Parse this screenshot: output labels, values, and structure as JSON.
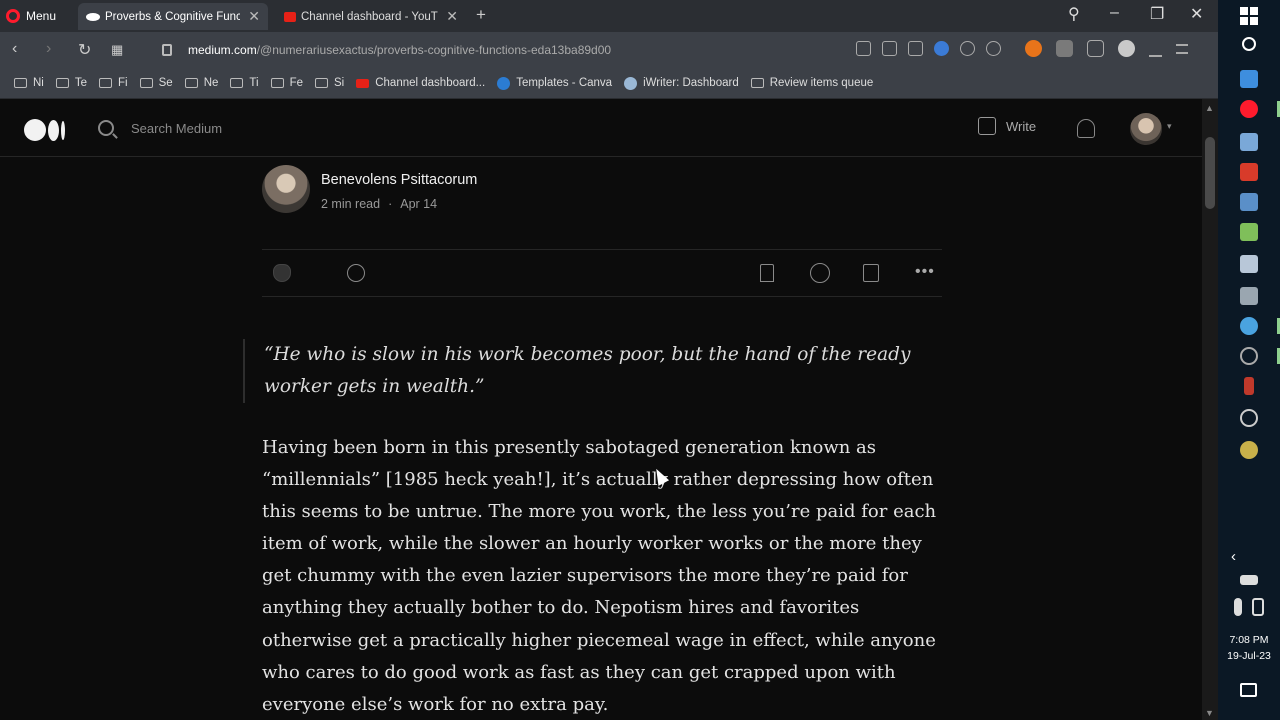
{
  "browser": {
    "menu_label": "Menu",
    "tabs": [
      {
        "title": "Proverbs & Cognitive Func",
        "favicon_color": "#ffffff"
      },
      {
        "title": "Channel dashboard - YouT",
        "favicon_color": "#e62117"
      }
    ],
    "url_host": "medium.com",
    "url_path": "/@numerariusexactus/proverbs-cognitive-functions-eda13ba89d00",
    "bookmarks": [
      {
        "label": "Ni",
        "icon": "folder-icon"
      },
      {
        "label": "Te",
        "icon": "folder-icon"
      },
      {
        "label": "Fi",
        "icon": "folder-icon"
      },
      {
        "label": "Se",
        "icon": "folder-icon"
      },
      {
        "label": "Ne",
        "icon": "folder-icon"
      },
      {
        "label": "Ti",
        "icon": "folder-icon"
      },
      {
        "label": "Fe",
        "icon": "folder-icon"
      },
      {
        "label": "Si",
        "icon": "folder-icon"
      },
      {
        "label": "Channel dashboard...",
        "icon": "youtube-icon"
      },
      {
        "label": "Templates - Canva",
        "icon": "canva-icon"
      },
      {
        "label": "iWriter: Dashboard",
        "icon": "iwriter-icon"
      },
      {
        "label": "Review items queue",
        "icon": "folder-icon"
      }
    ]
  },
  "medium": {
    "search_placeholder": "Search Medium",
    "write_label": "Write",
    "author": {
      "name": "Benevolens Psittacorum",
      "read_time": "2 min read",
      "separator": "·",
      "date": "Apr 14"
    },
    "quote": "“He who is slow in his work becomes poor, but the hand of the ready worker gets in wealth.”",
    "body": "Having been born in this presently sabotaged generation known as “millennials” [1985 heck yeah!], it’s actually rather depressing how often this seems to be untrue. The more you work, the less you’re paid for each item of work, while the slower an hourly worker works or the more they get chummy with the even lazier supervisors the more they’re paid for anything they actually bother to do. Nepotism hires and favorites otherwise get a practically higher piecemeal wage in effect, while anyone who cares to do good work as fast as they can get crapped upon with everyone else’s work for no extra pay."
  },
  "taskbar": {
    "time": "7:08 PM",
    "date": "19-Jul-23"
  },
  "colors": {
    "accent_red": "#ff1b2d",
    "page_bg": "#0c0c0c",
    "chrome_bg": "#3c4047"
  }
}
